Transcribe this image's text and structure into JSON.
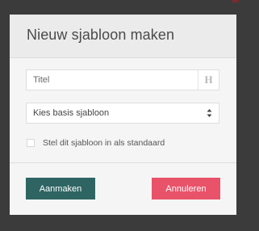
{
  "dialog": {
    "title": "Nieuw sjabloon maken"
  },
  "form": {
    "title_field": {
      "value": "",
      "placeholder": "Titel",
      "icon": "heading-icon",
      "icon_glyph": "H"
    },
    "template_select": {
      "selected": "Kies basis sjabloon",
      "icon": "sort-arrows-icon"
    },
    "default_checkbox": {
      "checked": false,
      "label": "Stel dit sjabloon in als standaard"
    }
  },
  "buttons": {
    "create": "Aanmaken",
    "cancel": "Annuleren"
  },
  "colors": {
    "create_button": "#2e6563",
    "cancel_button": "#e9536a",
    "header_background": "#ebebeb",
    "backdrop": "#3b3b3b"
  }
}
